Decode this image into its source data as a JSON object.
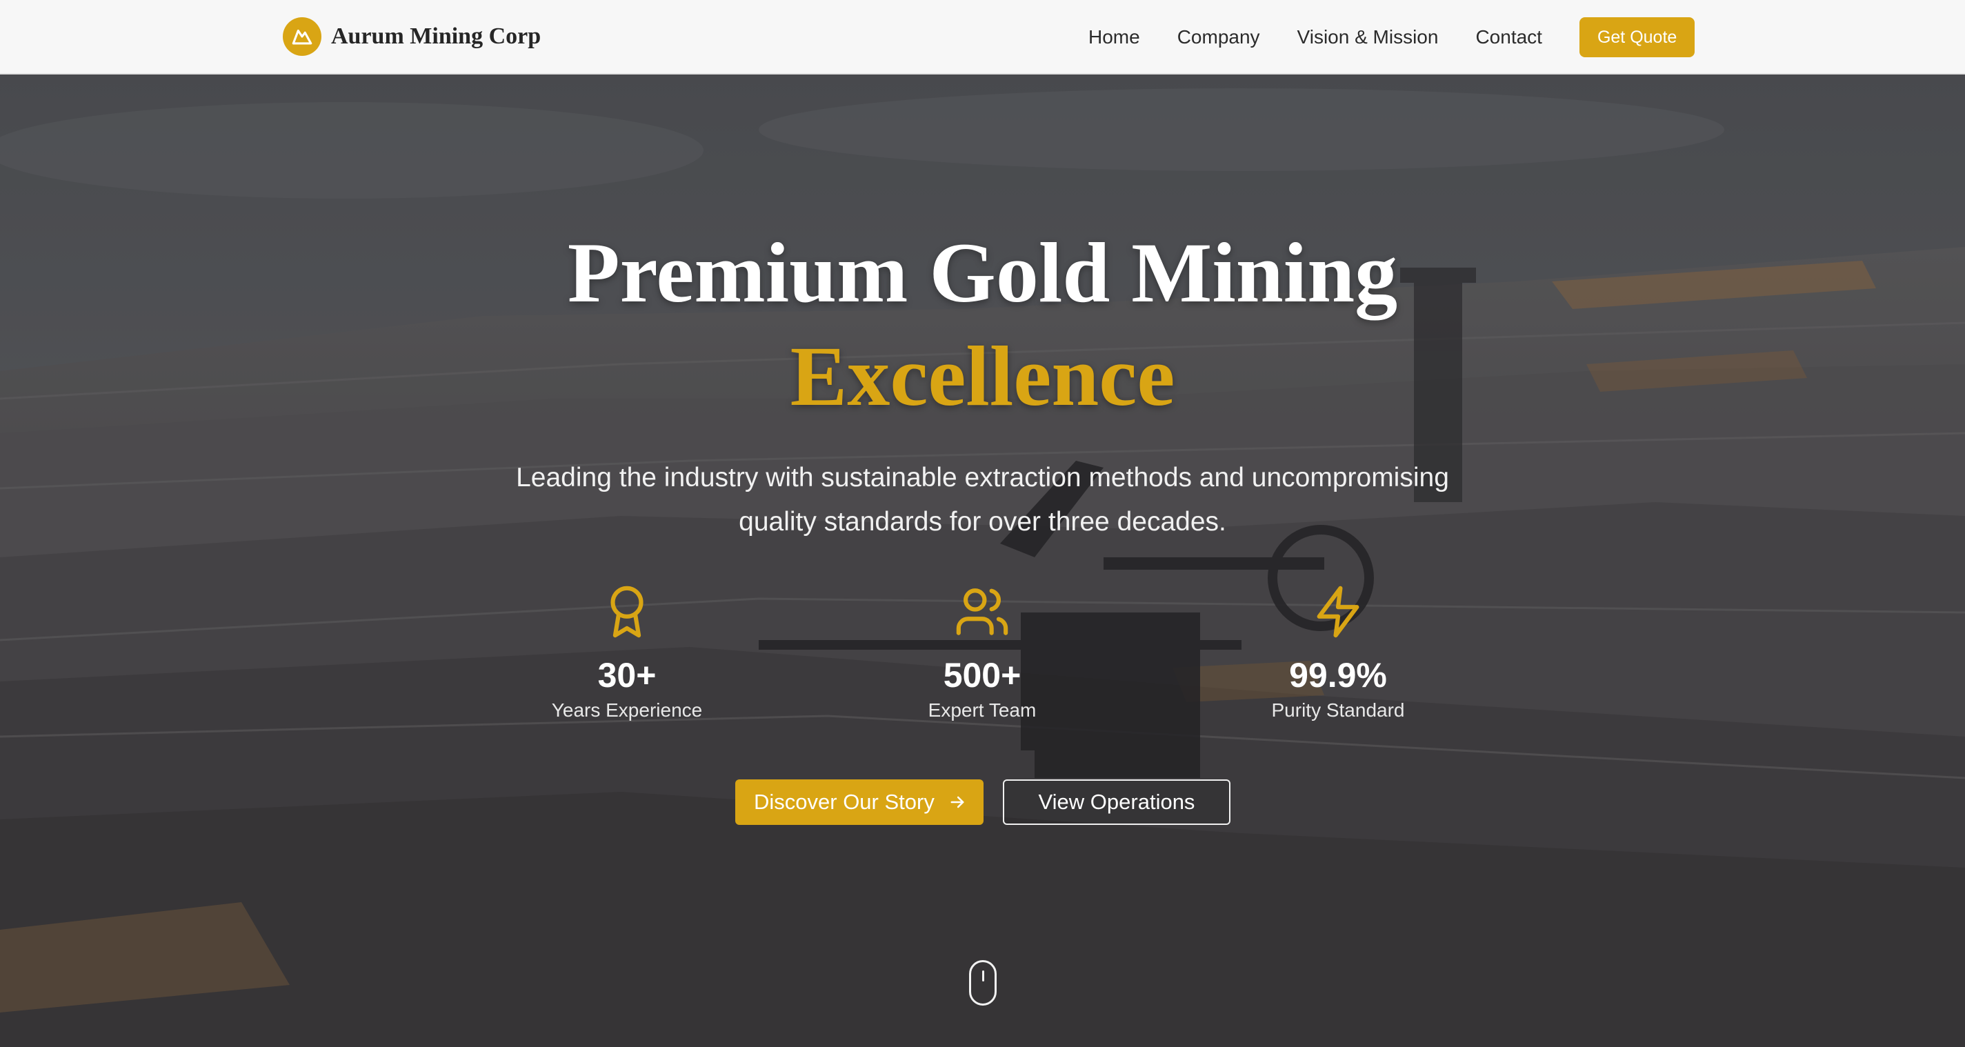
{
  "brand": {
    "name": "Aurum Mining Corp",
    "logo_icon": "mountain-icon",
    "accent": "#d9a514"
  },
  "nav": {
    "links": [
      {
        "label": "Home"
      },
      {
        "label": "Company"
      },
      {
        "label": "Vision & Mission"
      },
      {
        "label": "Contact"
      }
    ],
    "cta_label": "Get Quote"
  },
  "hero": {
    "title_line1": "Premium Gold Mining",
    "title_line2": "Excellence",
    "subtitle_line1": "Leading the industry with sustainable extraction methods and uncompromising",
    "subtitle_line2": "quality standards for over three decades.",
    "background": "open-pit-mine-with-bucket-wheel-excavator",
    "stats": [
      {
        "icon": "award-icon",
        "value": "30+",
        "label": "Years Experience"
      },
      {
        "icon": "users-icon",
        "value": "500+",
        "label": "Expert Team"
      },
      {
        "icon": "lightning-icon",
        "value": "99.9%",
        "label": "Purity Standard"
      }
    ],
    "primary_button": "Discover Our Story",
    "primary_button_icon": "arrow-right-icon",
    "secondary_button": "View Operations",
    "scroll_indicator_icon": "mouse-scroll-icon"
  }
}
